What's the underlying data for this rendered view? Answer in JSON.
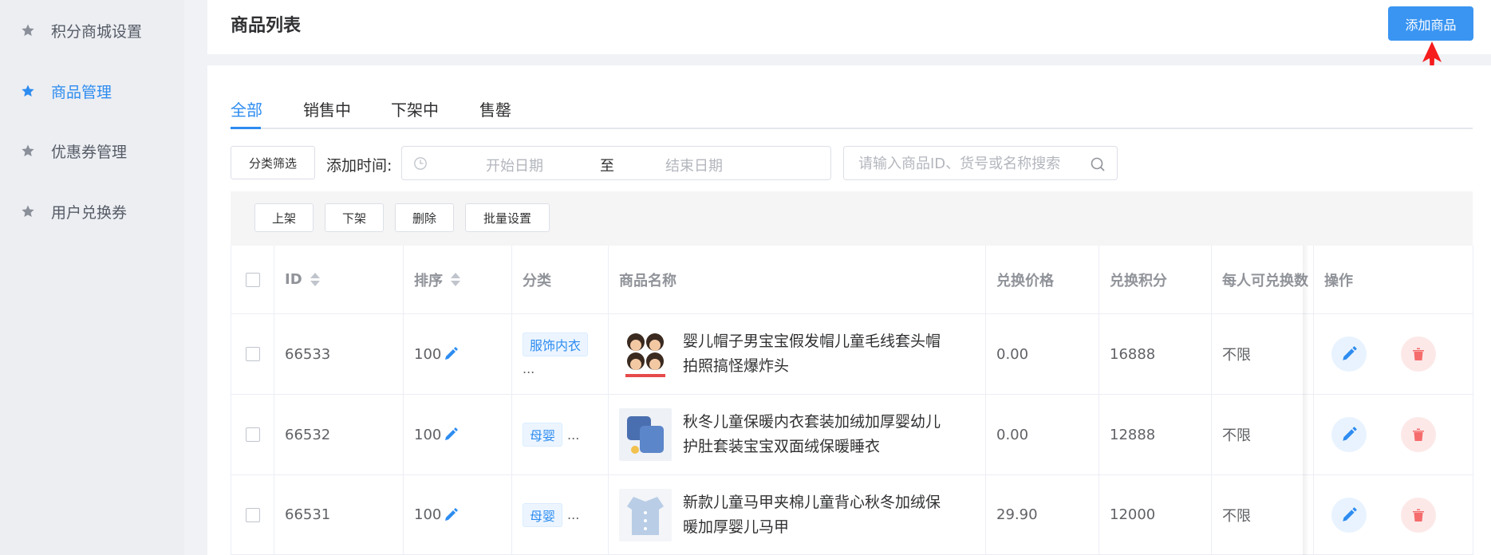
{
  "sidebar": {
    "items": [
      {
        "label": "积分商城设置",
        "active": false
      },
      {
        "label": "商品管理",
        "active": true
      },
      {
        "label": "优惠券管理",
        "active": false
      },
      {
        "label": "用户兑换券",
        "active": false
      }
    ]
  },
  "header": {
    "title": "商品列表",
    "add_button": "添加商品"
  },
  "tabs": [
    {
      "label": "全部",
      "active": true
    },
    {
      "label": "销售中",
      "active": false
    },
    {
      "label": "下架中",
      "active": false
    },
    {
      "label": "售罄",
      "active": false
    }
  ],
  "filters": {
    "category_button": "分类筛选",
    "date_label": "添加时间:",
    "start_placeholder": "开始日期",
    "separator": "至",
    "end_placeholder": "结束日期",
    "search_placeholder": "请输入商品ID、货号或名称搜索"
  },
  "bulk_actions": {
    "shelve": "上架",
    "unshelve": "下架",
    "delete": "删除",
    "batch": "批量设置"
  },
  "table": {
    "columns": {
      "id": "ID",
      "sort": "排序",
      "category": "分类",
      "name": "商品名称",
      "price": "兑换价格",
      "points": "兑换积分",
      "limit": "每人可兑换数",
      "ops": "操作"
    },
    "rows": [
      {
        "id": "66533",
        "sort": "100",
        "category": "服饰内衣",
        "more": "...",
        "name": "婴儿帽子男宝宝假发帽儿童毛线套头帽拍照搞怪爆炸头",
        "price": "0.00",
        "points": "16888",
        "limit": "不限"
      },
      {
        "id": "66532",
        "sort": "100",
        "category": "母婴",
        "more": "...",
        "name": "秋冬儿童保暖内衣套装加绒加厚婴幼儿护肚套装宝宝双面绒保暖睡衣",
        "price": "0.00",
        "points": "12888",
        "limit": "不限"
      },
      {
        "id": "66531",
        "sort": "100",
        "category": "母婴",
        "more": "...",
        "name": "新款儿童马甲夹棉儿童背心秋冬加绒保暖加厚婴儿马甲",
        "price": "29.90",
        "points": "12000",
        "limit": "不限"
      }
    ]
  },
  "colors": {
    "primary": "#2d8cf0",
    "button": "#3a95f2",
    "danger": "#f56c6c",
    "arrow": "#f51d1d"
  }
}
